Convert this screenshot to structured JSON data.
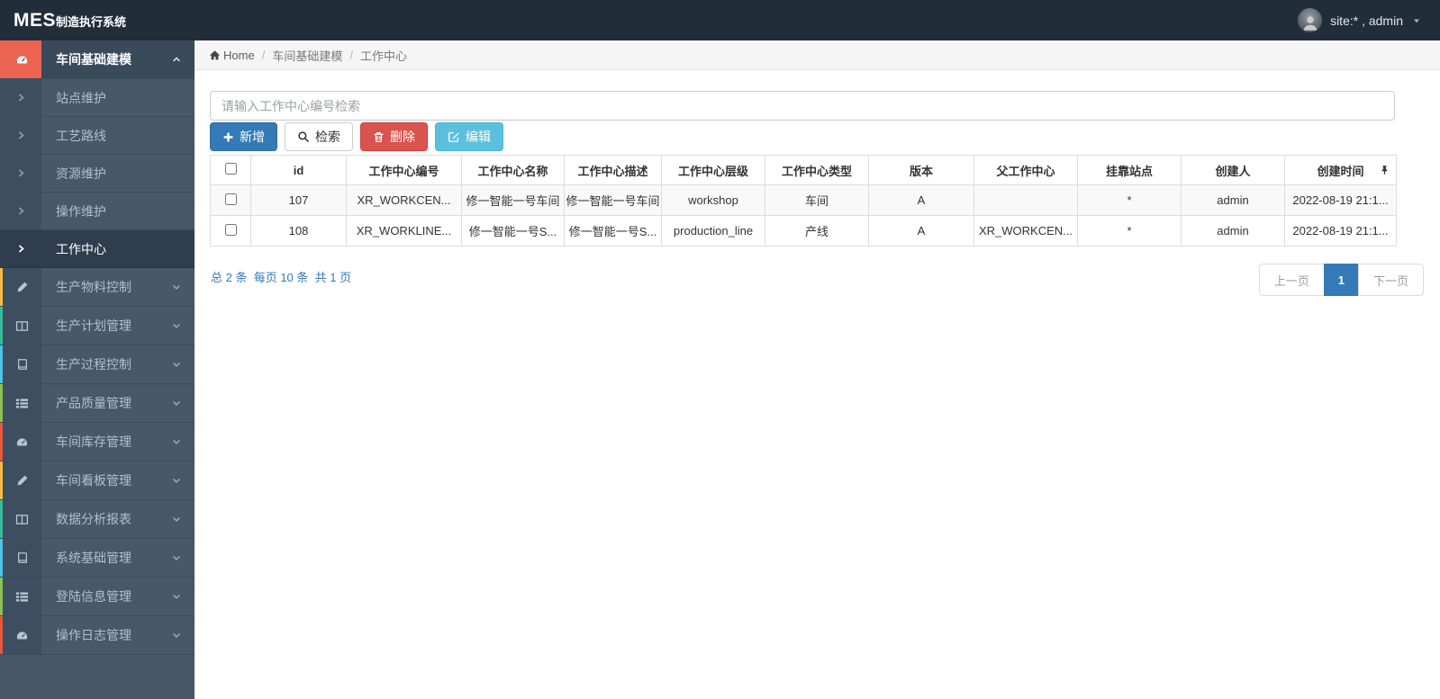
{
  "navbar": {
    "brand_bold": "MES",
    "brand_rest": "制造执行系统",
    "user_label": "site:* , admin"
  },
  "sidebar": {
    "items": [
      {
        "type": "parent",
        "label": "车间基础建模",
        "icon": "tachometer-icon",
        "accent": "#ec6352",
        "active": true,
        "expanded": true
      },
      {
        "type": "sub",
        "label": "站点维护",
        "active": false
      },
      {
        "type": "sub",
        "label": "工艺路线",
        "active": false
      },
      {
        "type": "sub",
        "label": "资源维护",
        "active": false
      },
      {
        "type": "sub",
        "label": "操作维护",
        "active": false
      },
      {
        "type": "sub",
        "label": "工作中心",
        "active": true
      },
      {
        "type": "parent",
        "label": "生产物料控制",
        "icon": "pencil-icon",
        "accent": "#f6bb42",
        "active": false,
        "expanded": false
      },
      {
        "type": "parent",
        "label": "生产计划管理",
        "icon": "columns-icon",
        "accent": "#37bc9b",
        "active": false,
        "expanded": false
      },
      {
        "type": "parent",
        "label": "生产过程控制",
        "icon": "book-icon",
        "accent": "#4fc1e9",
        "active": false,
        "expanded": false
      },
      {
        "type": "parent",
        "label": "产品质量管理",
        "icon": "list-icon",
        "accent": "#8cc152",
        "active": false,
        "expanded": false
      },
      {
        "type": "parent",
        "label": "车间库存管理",
        "icon": "tachometer-icon",
        "accent": "#e9573f",
        "active": false,
        "expanded": false
      },
      {
        "type": "parent",
        "label": "车间看板管理",
        "icon": "pencil-icon",
        "accent": "#f6bb42",
        "active": false,
        "expanded": false
      },
      {
        "type": "parent",
        "label": "数据分析报表",
        "icon": "columns-icon",
        "accent": "#37bc9b",
        "active": false,
        "expanded": false
      },
      {
        "type": "parent",
        "label": "系统基础管理",
        "icon": "book-icon",
        "accent": "#4fc1e9",
        "active": false,
        "expanded": false
      },
      {
        "type": "parent",
        "label": "登陆信息管理",
        "icon": "list-icon",
        "accent": "#8cc152",
        "active": false,
        "expanded": false
      },
      {
        "type": "parent",
        "label": "操作日志管理",
        "icon": "tachometer-icon",
        "accent": "#e9573f",
        "active": false,
        "expanded": false
      }
    ]
  },
  "breadcrumb": {
    "home": "Home",
    "items": [
      "车间基础建模",
      "工作中心"
    ]
  },
  "toolbar": {
    "search_placeholder": "请输入工作中心编号检索",
    "search_value": "",
    "buttons": [
      {
        "label": "新增",
        "icon": "plus-icon",
        "style": "primary"
      },
      {
        "label": "检索",
        "icon": "search-icon",
        "style": "default"
      },
      {
        "label": "删除",
        "icon": "trash-icon",
        "style": "danger"
      },
      {
        "label": "编辑",
        "icon": "edit-icon",
        "style": "info"
      }
    ]
  },
  "table": {
    "columns": [
      "id",
      "工作中心编号",
      "工作中心名称",
      "工作中心描述",
      "工作中心层级",
      "工作中心类型",
      "版本",
      "父工作中心",
      "挂靠站点",
      "创建人",
      "创建时间"
    ],
    "rows": [
      [
        "107",
        "XR_WORKCEN...",
        "修一智能一号车间",
        "修一智能一号车间",
        "workshop",
        "车间",
        "A",
        "",
        "*",
        "admin",
        "2022-08-19 21:1..."
      ],
      [
        "108",
        "XR_WORKLINE...",
        "修一智能一号S...",
        "修一智能一号S...",
        "production_line",
        "产线",
        "A",
        "XR_WORKCEN...",
        "*",
        "admin",
        "2022-08-19 21:1..."
      ]
    ]
  },
  "pagination": {
    "summary_total": "总 2 条",
    "summary_per_page": "每页 10 条",
    "summary_pages": "共 1 页",
    "prev": "上一页",
    "current": "1",
    "next": "下一页"
  },
  "colors": {
    "navbar_bg": "#222d3a",
    "sidebar_bg": "#47586a",
    "sidebar_icon_col": "#3d4e60",
    "active_red": "#ec6352",
    "accent_yellow": "#f6bb42",
    "accent_teal": "#37bc9b",
    "accent_cyan": "#4fc1e9",
    "accent_green": "#8cc152",
    "primary_blue": "#337ab7",
    "danger_red": "#d9534f",
    "info_blue": "#5bc0de"
  }
}
